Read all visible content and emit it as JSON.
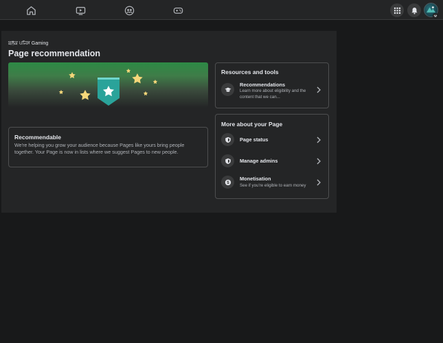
{
  "topnav": {
    "items": [
      {
        "name": "home",
        "icon": "home-icon"
      },
      {
        "name": "watch",
        "icon": "video-icon"
      },
      {
        "name": "groups",
        "icon": "groups-icon"
      },
      {
        "name": "gaming",
        "icon": "gamepad-icon"
      }
    ],
    "right": [
      "menu-grid-icon",
      "bell-icon",
      "avatar"
    ]
  },
  "header": {
    "page_name": "ਬਲੱਕ ਪਜਿਸ Gaming",
    "title": "Page recommendation"
  },
  "recommendable": {
    "title": "Recommendable",
    "body": "We're helping you grow your audience because Pages like yours bring people together. Your Page is now in lists where we suggest Pages to new people."
  },
  "resources": {
    "heading": "Resources and tools",
    "items": [
      {
        "icon": "graduation-cap-icon",
        "title": "Recommendations",
        "subtitle": "Learn more about eligibility and the content that we can..."
      }
    ]
  },
  "more": {
    "heading": "More about your Page",
    "items": [
      {
        "icon": "shield-icon",
        "title": "Page status",
        "subtitle": ""
      },
      {
        "icon": "shield-icon",
        "title": "Manage admins",
        "subtitle": ""
      },
      {
        "icon": "dollar-coin-icon",
        "title": "Monetisation",
        "subtitle": "See if you're eligible to earn money"
      }
    ]
  },
  "colors": {
    "background": "#18191a",
    "surface": "#242526",
    "accent_green": "#2d8a45",
    "badge_teal": "#2aa39a",
    "star_yellow": "#f5d77a"
  }
}
